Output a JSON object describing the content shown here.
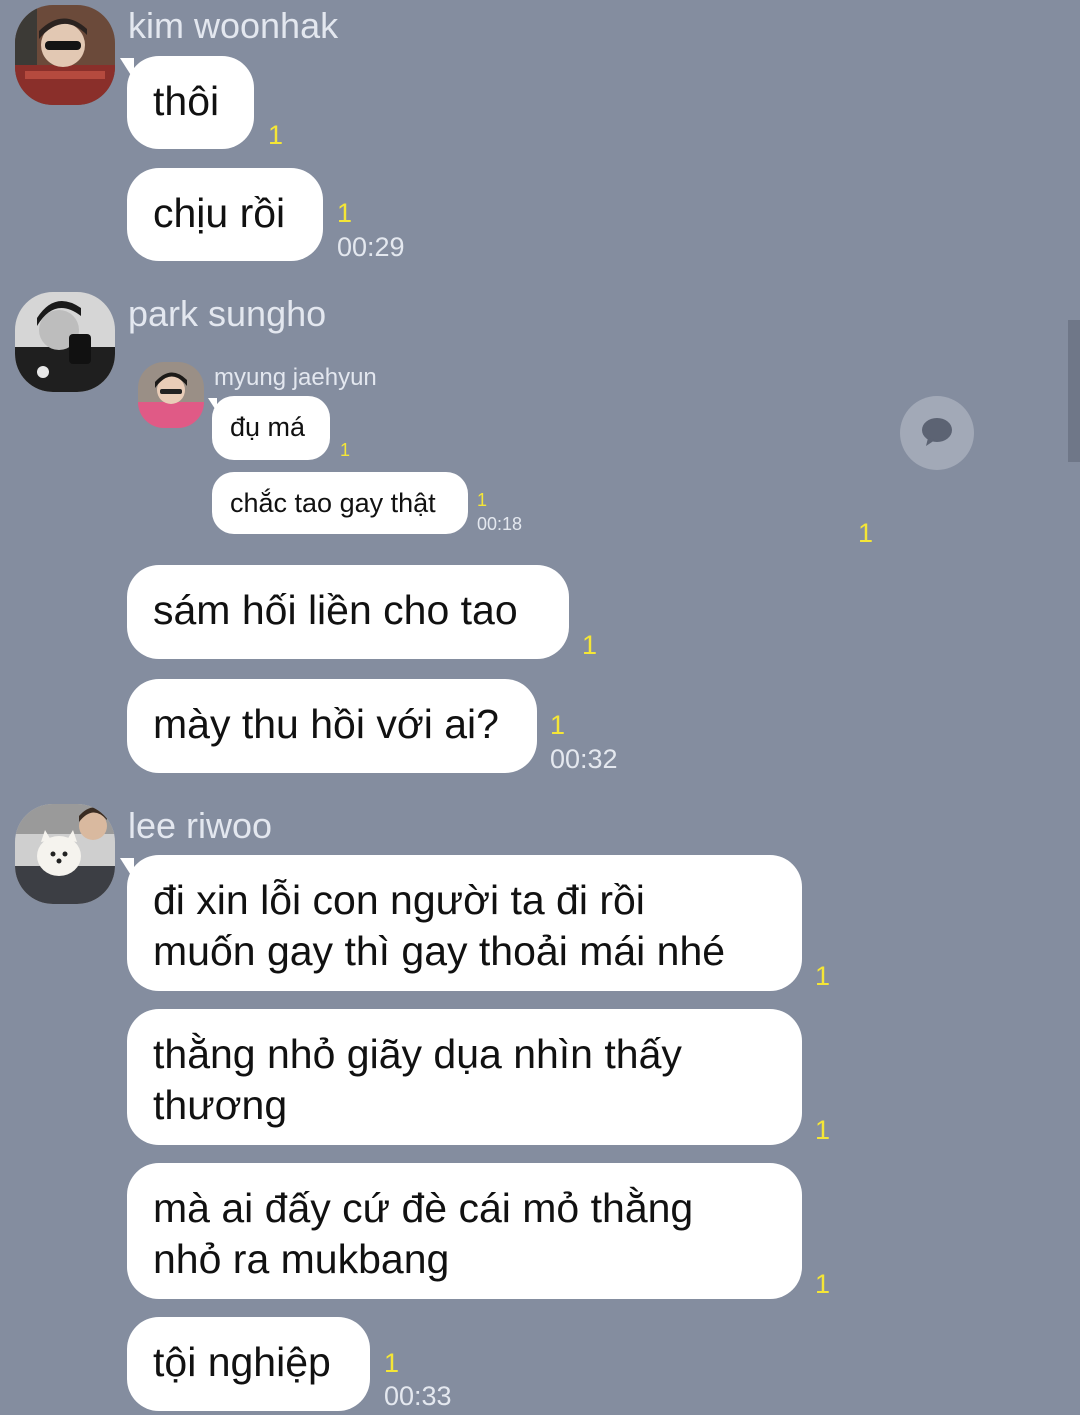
{
  "colors": {
    "background": "#848d9f",
    "bubble": "#ffffff",
    "unread": "#f5e636",
    "meta_text": "#e4e8ef"
  },
  "groups": [
    {
      "sender": "kim woonhak",
      "messages": [
        {
          "text": "thôi",
          "unread": "1"
        },
        {
          "text": "chịu rồi",
          "unread": "1",
          "time": "00:29"
        }
      ]
    },
    {
      "sender": "park sungho",
      "quoted": {
        "sender": "myung jaehyun",
        "messages": [
          {
            "text": "đụ má",
            "unread": "1"
          },
          {
            "text": "chắc tao gay thật",
            "unread": "1",
            "time": "00:18"
          }
        ],
        "unread": "1",
        "share_icon": "speech-bubble-icon"
      },
      "messages": [
        {
          "text": "sám hối liền cho tao",
          "unread": "1"
        },
        {
          "text": "mày thu hồi với ai?",
          "unread": "1",
          "time": "00:32"
        }
      ]
    },
    {
      "sender": "lee riwoo",
      "messages": [
        {
          "line1": "đi xin lỗi con người ta đi rồi",
          "line2": "muốn gay thì gay thoải mái nhé",
          "unread": "1"
        },
        {
          "line1": "thằng nhỏ giãy dụa nhìn thấy",
          "line2": "thương",
          "unread": "1"
        },
        {
          "line1": "mà ai đấy cứ đè cái mỏ thằng",
          "line2": "nhỏ ra mukbang",
          "unread": "1"
        },
        {
          "text": "tội nghiệp",
          "unread": "1",
          "time": "00:33"
        }
      ]
    }
  ]
}
